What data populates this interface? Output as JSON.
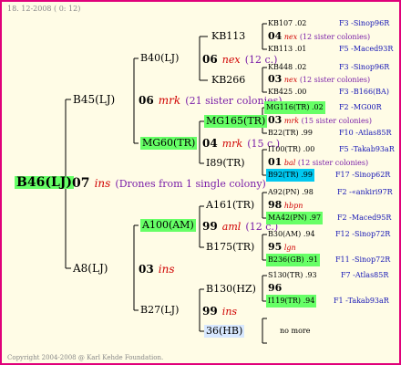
{
  "header": {
    "date": "18. 12-2008 ( 0: 12)"
  },
  "footer": {
    "copyright": "Copyright 2004-2008 @ Karl Kehde Foundation."
  },
  "root": {
    "name": "B46(LJ)",
    "gen": "07",
    "ins": "ins",
    "note": "(Drones from 1 single colony)"
  },
  "g1": {
    "sire": {
      "name": "B45(LJ)",
      "gen": "06",
      "ins": "mrk",
      "note": "(21 sister colonies)"
    },
    "dam": {
      "name": "A8(LJ)",
      "gen": "03",
      "ins": "ins"
    }
  },
  "g2": {
    "b40": {
      "name": "B40(LJ)",
      "gen": "06",
      "ins": "nex",
      "note": "(12 c.)"
    },
    "mg60": {
      "name": "MG60(TR)",
      "gen": "04",
      "ins": "mrk",
      "note": "(15 c.)"
    },
    "a100": {
      "name": "A100(AM)",
      "gen": "99",
      "ins": "aml",
      "note": "(12 c.)"
    },
    "b27": {
      "name": "B27(LJ)",
      "gen": "99",
      "ins": "ins"
    }
  },
  "g3": {
    "kb113": "KB113",
    "kb266": "KB266",
    "mg165": "MG165(TR)",
    "i89": "I89(TR)",
    "a161": "A161(TR)",
    "b175": "B175(TR)",
    "b130": "B130(HZ)",
    "h36": "36(HB)"
  },
  "g4": [
    {
      "name": "KB107",
      "val": ".02",
      "anc": "F3 -Sinop96R"
    },
    {
      "gen": "04",
      "ins": "nex",
      "note": "(12 sister colonies)"
    },
    {
      "name": "KB113",
      "val": ".01",
      "anc": "F5 -Maced93R"
    },
    {
      "name": "KB448",
      "val": ".02",
      "anc": "F3 -Sinop96R"
    },
    {
      "gen": "03",
      "ins": "nex",
      "note": "(12 sister colonies)"
    },
    {
      "name": "KB425",
      "val": ".00",
      "anc": "F3 -B166(BA)"
    },
    {
      "name": "MG116(TR)",
      "val": ".02",
      "anc": "F2 -MG00R"
    },
    {
      "gen": "03",
      "ins": "mrk",
      "note": "(15 sister colonies)"
    },
    {
      "name": "B22(TR)",
      "val": ".99",
      "anc": "F10 -Atlas85R"
    },
    {
      "name": "I100(TR)",
      "val": ".00",
      "anc": "F5 -Takab93aR"
    },
    {
      "gen": "01",
      "ins": "bal",
      "note": "(12 sister colonies)"
    },
    {
      "name": "B92(TR)",
      "val": ".99",
      "anc": "F17 -Sinop62R"
    },
    {
      "name": "A92(PN)",
      "val": ".98",
      "anc": "F2 -«ankiri97R"
    },
    {
      "gen": "98",
      "ins": "hbpn"
    },
    {
      "name": "MA42(PN)",
      "val": ".97",
      "anc": "F2 -Maced95R"
    },
    {
      "name": "B30(AM)",
      "val": ".94",
      "anc": "F12 -Sinop72R"
    },
    {
      "gen": "95",
      "ins": "lgn"
    },
    {
      "name": "B236(GB)",
      "val": ".91",
      "anc": "F11 -Sinop72R"
    },
    {
      "name": "S130(TR)",
      "val": ".93",
      "anc": "F7 -Atlas85R"
    },
    {
      "gen": "96"
    },
    {
      "name": "I119(TR)",
      "val": ".94",
      "anc": "F1 -Takab93aR"
    },
    {
      "note": "no more"
    }
  ],
  "colors": {
    "border": "#e0007a",
    "bg": "#fffce6",
    "highlight": "#66ff66",
    "ins": "#d00000",
    "note": "#7a1ea8",
    "ancestor": "#1515b5"
  }
}
